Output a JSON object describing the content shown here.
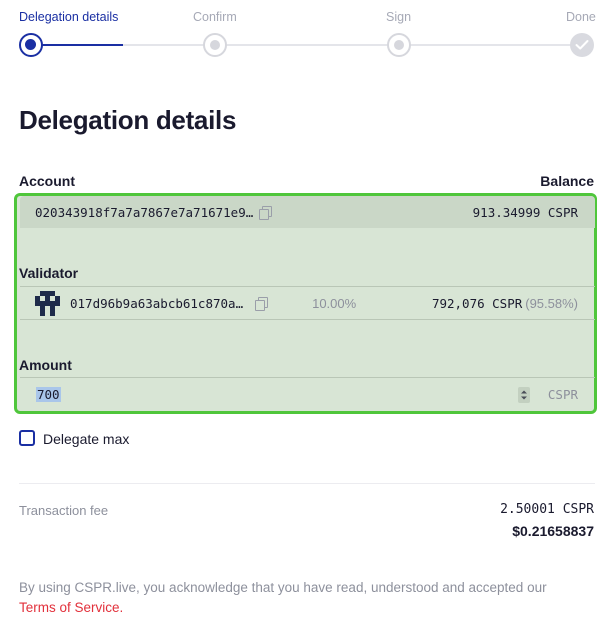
{
  "stepper": {
    "steps": [
      {
        "label": "Delegation details",
        "state": "active"
      },
      {
        "label": "Confirm",
        "state": "pending"
      },
      {
        "label": "Sign",
        "state": "pending"
      },
      {
        "label": "Done",
        "state": "done"
      }
    ]
  },
  "page": {
    "title": "Delegation details"
  },
  "account": {
    "label": "Account",
    "balance_label": "Balance",
    "public_key": "020343918f7a7a7867e7a71671e9…",
    "balance": "913.34999 CSPR"
  },
  "validator": {
    "label": "Validator",
    "public_key": "017d96b9a63abcb61c870a…",
    "fee": "10.00%",
    "stake": "792,076 CSPR",
    "stake_share": "(95.58%)"
  },
  "amount": {
    "label": "Amount",
    "value": "700",
    "unit": "CSPR"
  },
  "delegate_max": {
    "label": "Delegate max",
    "checked": false
  },
  "fee": {
    "label": "Transaction fee",
    "cspr": "2.50001 CSPR",
    "usd": "$0.21658837"
  },
  "terms": {
    "text": "By using CSPR.live, you acknowledge that you have read, understood and accepted our",
    "link": "Terms of Service."
  },
  "colors": {
    "accent": "#1a2fa3",
    "highlight_border": "#4fc63b",
    "highlight_fill": "#d8e5d5",
    "link": "#e2303b"
  }
}
